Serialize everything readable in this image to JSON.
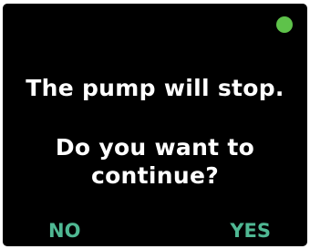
{
  "status_indicator": {
    "icon": "status-dot-icon",
    "color": "#5ec24a"
  },
  "message": {
    "line1": "The pump will stop.",
    "line2": "Do you want to",
    "line3": "continue?"
  },
  "actions": {
    "no_label": "NO",
    "yes_label": "YES",
    "color": "#4fb893"
  }
}
